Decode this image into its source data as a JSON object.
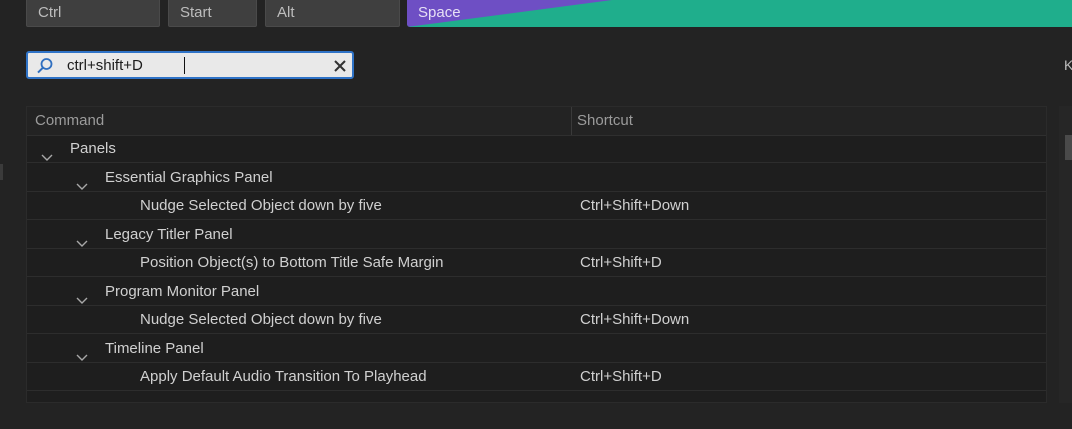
{
  "keyboard": {
    "keys": [
      {
        "label": "Ctrl"
      },
      {
        "label": "Start"
      },
      {
        "label": "Alt"
      }
    ],
    "space": {
      "label": "Space",
      "highlight_colors": [
        "#6e4fc4",
        "#1fae8c"
      ]
    }
  },
  "search": {
    "value": "ctrl+shift+D",
    "icon": "search-icon",
    "clear_icon": "close-icon"
  },
  "side_label": "K",
  "table": {
    "columns": {
      "command": "Command",
      "shortcut": "Shortcut"
    },
    "rows": [
      {
        "level": 0,
        "type": "group",
        "label": "Panels",
        "shortcut": ""
      },
      {
        "level": 1,
        "type": "group",
        "label": "Essential Graphics Panel",
        "shortcut": ""
      },
      {
        "level": 2,
        "type": "item",
        "label": "Nudge Selected Object down by five",
        "shortcut": "Ctrl+Shift+Down"
      },
      {
        "level": 1,
        "type": "group",
        "label": "Legacy Titler Panel",
        "shortcut": ""
      },
      {
        "level": 2,
        "type": "item",
        "label": "Position Object(s) to Bottom Title Safe Margin",
        "shortcut": "Ctrl+Shift+D"
      },
      {
        "level": 1,
        "type": "group",
        "label": "Program Monitor Panel",
        "shortcut": ""
      },
      {
        "level": 2,
        "type": "item",
        "label": "Nudge Selected Object down by five",
        "shortcut": "Ctrl+Shift+Down"
      },
      {
        "level": 1,
        "type": "group",
        "label": "Timeline Panel",
        "shortcut": ""
      },
      {
        "level": 2,
        "type": "item",
        "label": "Apply Default Audio Transition To Playhead",
        "shortcut": "Ctrl+Shift+D"
      }
    ]
  }
}
